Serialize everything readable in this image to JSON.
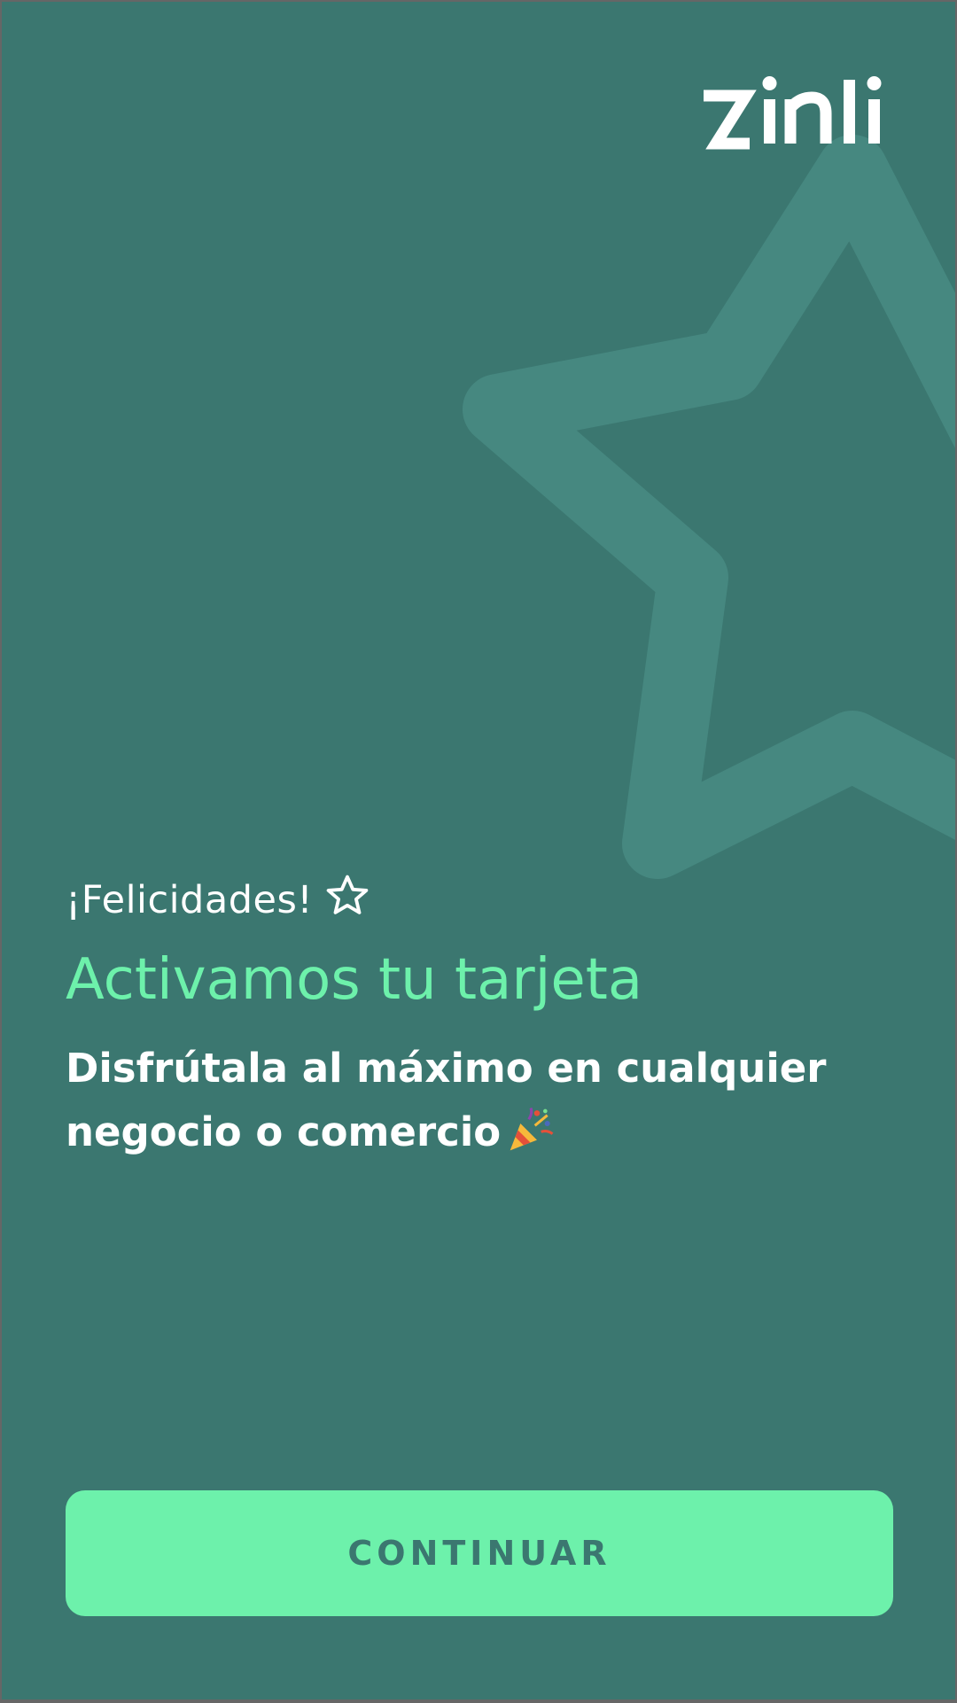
{
  "brand": {
    "logo_text": "zinli"
  },
  "success": {
    "greeting": "¡Felicidades!",
    "headline": "Activamos tu tarjeta",
    "subtitle": "Disfrútala al máximo en cualquier negocio o comercio"
  },
  "actions": {
    "continue_label": "CONTINUAR"
  },
  "icons": {
    "greeting_icon": "star-outline-icon",
    "subtitle_icon": "party-popper-icon",
    "background": "star-outline-background"
  },
  "colors": {
    "background": "#3b7770",
    "accent": "#6df1ab",
    "text": "#ffffff",
    "button_text": "#3b7770"
  }
}
